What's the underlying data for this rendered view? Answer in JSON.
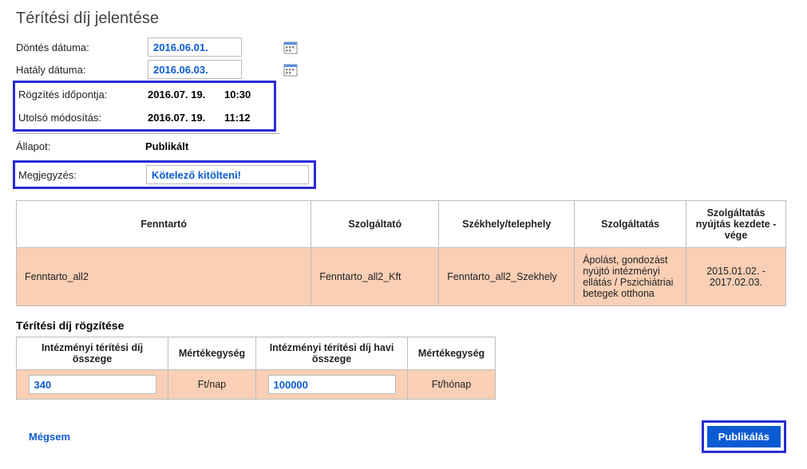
{
  "title": "Térítési díj jelentése",
  "form": {
    "decision_date_label": "Döntés dátuma:",
    "decision_date": "2016.06.01.",
    "effective_date_label": "Hatály dátuma:",
    "effective_date": "2016.06.03.",
    "record_time_label": "Rögzítés időpontja:",
    "record_date": "2016.07. 19.",
    "record_time": "10:30",
    "lastmod_label": "Utolsó módosítás:",
    "lastmod_date": "2016.07. 19.",
    "lastmod_time": "11:12",
    "state_label": "Állapot:",
    "state_value": "Publikált",
    "comment_label": "Megjegyzés:",
    "comment_value": "Kötelező kitölteni!"
  },
  "table1": {
    "headers": {
      "maintainer": "Fenntartó",
      "provider": "Szolgáltató",
      "site": "Székhely/telephely",
      "service": "Szolgáltatás",
      "period": "Szolgáltatás nyújtás kezdete - vége"
    },
    "row": {
      "maintainer": "Fenntarto_all2",
      "provider": "Fenntarto_all2_Kft",
      "site": "Fenntarto_all2_Szekhely",
      "service": "Ápolást, gondozást nyújtó intézményi ellátás / Pszichiátriai betegek otthona",
      "period": "2015.01.02. - 2017.02.03."
    }
  },
  "fee_section_title": "Térítési díj rögzítése",
  "fee_table": {
    "headers": {
      "amount": "Intézményi térítési díj összege",
      "unit": "Mértékegység",
      "monthly": "Intézményi térítési díj havi összege",
      "unit2": "Mértékegység"
    },
    "row": {
      "amount": "340",
      "unit": "Ft/nap",
      "monthly": "100000",
      "unit2": "Ft/hónap"
    }
  },
  "buttons": {
    "cancel": "Mégsem",
    "publish": "Publikálás"
  }
}
